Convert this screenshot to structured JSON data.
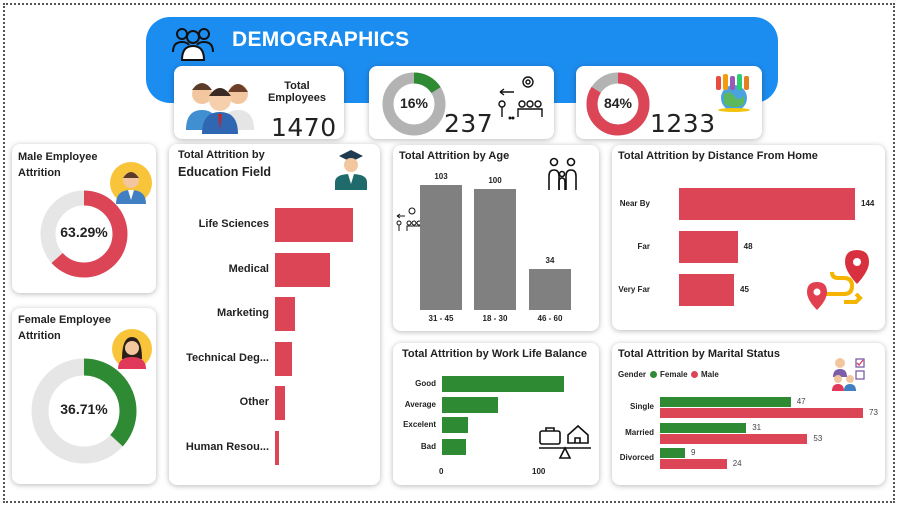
{
  "header": {
    "title": "DEMOGRAPHICS",
    "icon": "team-icon"
  },
  "kpis": {
    "total_employees": {
      "label": "Total Employees",
      "value": "1470"
    },
    "attrition": {
      "percent_label": "16%",
      "percent": 16,
      "value": "237"
    },
    "retained": {
      "percent_label": "84%",
      "percent": 84,
      "value": "1233"
    }
  },
  "male_attrition": {
    "title": "Male Employee Attrition",
    "percent_label": "63.29%",
    "percent": 63.29
  },
  "female_attrition": {
    "title": "Female Employee Attrition",
    "percent_label": "36.71%",
    "percent": 36.71
  },
  "education": {
    "title_line1": "Total Attrition by",
    "title_line2": "Education Field",
    "categories": [
      "Life Sciences",
      "Medical",
      "Marketing",
      "Technical Deg...",
      "Other",
      "Human Resou..."
    ],
    "values": [
      89,
      63,
      23,
      19,
      11,
      4
    ]
  },
  "age": {
    "title": "Total Attrition by Age",
    "categories": [
      "31 - 45",
      "18 - 30",
      "46 - 60"
    ],
    "values": [
      103,
      100,
      34
    ],
    "value_labels": [
      "103",
      "100",
      "34"
    ]
  },
  "distance": {
    "title": "Total Attrition by Distance From Home",
    "categories": [
      "Near By",
      "Far",
      "Very Far"
    ],
    "values": [
      144,
      48,
      45
    ],
    "value_labels": [
      "144",
      "48",
      "45"
    ]
  },
  "work_life": {
    "title": "Total Attrition by Work Life Balance",
    "categories": [
      "Good",
      "Average",
      "Excelent",
      "Bad"
    ],
    "values": [
      127,
      58,
      27,
      25
    ],
    "axis_ticks": [
      "0",
      "100"
    ]
  },
  "marital": {
    "title": "Total Attrition by Marital Status",
    "legend_title": "Gender",
    "legend_female": "Female",
    "legend_male": "Male",
    "categories": [
      "Single",
      "Married",
      "Divorced"
    ],
    "female_values": [
      47,
      31,
      9
    ],
    "male_values": [
      73,
      53,
      24
    ],
    "female_labels": [
      "47",
      "31",
      "9"
    ],
    "male_labels": [
      "73",
      "53",
      "24"
    ]
  },
  "colors": {
    "accent": "#1c8df0",
    "red": "#dc4555",
    "green": "#2e8b34",
    "grey": "#808080",
    "track": "#e6e6e6"
  }
}
